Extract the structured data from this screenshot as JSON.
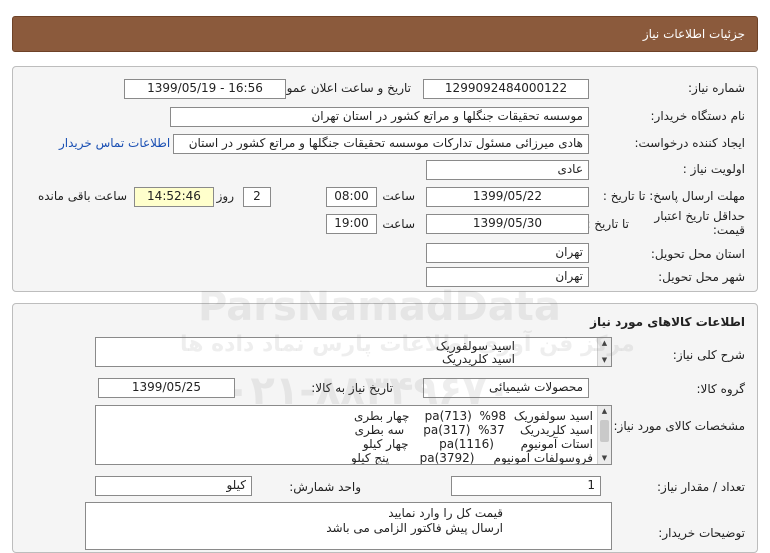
{
  "page_title": "جزئیات اطلاعات نیاز",
  "need": {
    "need_number_label": "شماره نیاز:",
    "need_number": "1299092484000122",
    "announce_label": "تاریخ و ساعت اعلان عمومی:",
    "announce_value": "1399/05/19 - 16:56",
    "buyer_org_label": "نام دستگاه خریدار:",
    "buyer_org": "موسسه تحقیقات جنگلها و مراتع کشور در استان تهران",
    "requester_label": "ایجاد کننده درخواست:",
    "requester": "هادی میرزائی مسئول تدارکات موسسه تحقیقات جنگلها و مراتع کشور در استان",
    "contact_link": "اطلاعات تماس خریدار",
    "priority_label": "اولویت نیاز :",
    "priority": "عادی",
    "deadline_label": "مهلت ارسال پاسخ: تا تاریخ :",
    "deadline_date": "1399/05/22",
    "time_label": "ساعت",
    "deadline_time": "08:00",
    "days_value": "2",
    "days_label": "روز و",
    "remaining_time": "14:52:46",
    "remaining_label": "ساعت باقی مانده",
    "validity_label_1": "حداقل تاریخ اعتبار",
    "validity_label_2": "قیمت:",
    "validity_until_label": "تا تاریخ :",
    "validity_date": "1399/05/30",
    "validity_time": "19:00",
    "province_label": "استان محل تحویل:",
    "province": "تهران",
    "city_label": "شهر محل تحویل:",
    "city": "تهران"
  },
  "goods": {
    "section_title": "اطلاعات کالاهای مورد نیاز",
    "summary_label": "شرح کلی نیاز:",
    "summary_lines": [
      "اسید سولفوریک",
      "اسید کلریدریک"
    ],
    "group_label": "گروه کالا:",
    "group_value": "محصولات شیمیائی",
    "need_date_label": "تاریخ نیاز به کالا:",
    "need_date": "1399/05/25",
    "specs_label": "مشخصات کالای مورد نیاز:",
    "specs_lines": [
      "اسید سولفوریک  98%  pa(713)    چهار بطری",
      "اسید کلریدریک    37%  pa(317)     سه بطری",
      "استات آمونیوم       pa(1116)        چهار کیلو",
      "فروسولفات آمونیوم     pa(3792)        پنج کیلو"
    ],
    "qty_label": "تعداد / مقدار نیاز:",
    "qty_value": "1",
    "unit_label": "واحد شمارش:",
    "unit_value": "کیلو",
    "buyer_notes_label": "توضیحات خریدار:",
    "buyer_notes_lines": [
      "قیمت کل را وارد نمایید",
      "ارسال پیش فاکتور الزامی می باشد"
    ]
  },
  "watermark": {
    "text_en": "ParsNamadData",
    "text_fa": "مرکز فن آوری اطلاعات پارس نماد داده ها",
    "text_phone": "۰۲۱-۸۸۳۴۹۶۷۰"
  }
}
